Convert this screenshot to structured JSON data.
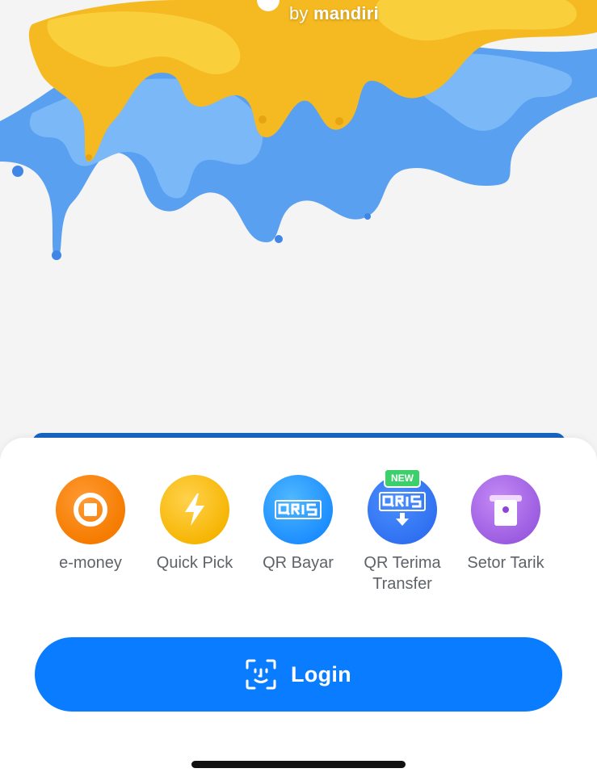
{
  "brand": {
    "by": "by",
    "name": "mandiri"
  },
  "shortcuts": [
    {
      "label": "e-money",
      "icon": "emoney-icon",
      "color": "#f57c00"
    },
    {
      "label": "Quick Pick",
      "icon": "lightning-icon",
      "color": "#f6b400"
    },
    {
      "label": "QR Bayar",
      "icon": "qris-icon",
      "color": "#1a8cff"
    },
    {
      "label": "QR Terima Transfer",
      "icon": "qris-receive-icon",
      "color": "#2f6ff0",
      "badge": "NEW"
    },
    {
      "label": "Setor Tarik",
      "icon": "atm-icon",
      "color": "#9a5ae0"
    }
  ],
  "login": {
    "label": "Login",
    "icon": "face-id-icon",
    "color": "#0a7cff"
  }
}
